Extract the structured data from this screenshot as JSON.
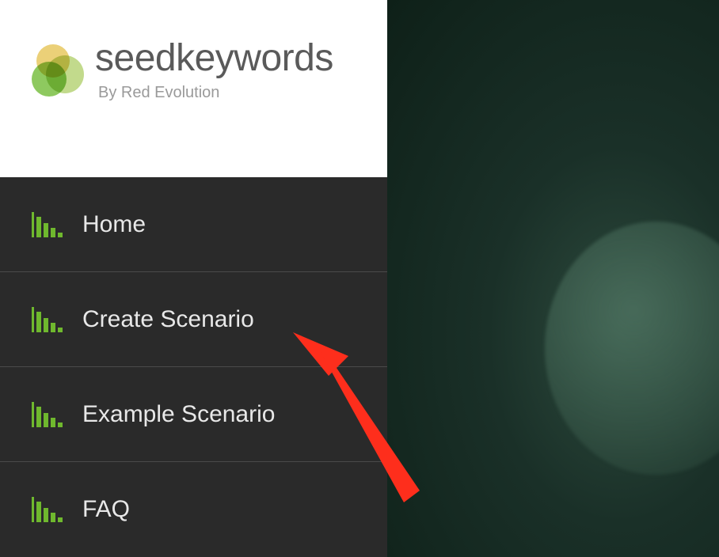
{
  "logo": {
    "bold": "seed",
    "light": "keywords",
    "tagline": "By Red Evolution"
  },
  "nav": {
    "items": [
      {
        "label": "Home"
      },
      {
        "label": "Create Scenario"
      },
      {
        "label": "Example Scenario"
      },
      {
        "label": "FAQ"
      }
    ]
  },
  "annotation": {
    "arrow_target": "create-scenario"
  },
  "colors": {
    "accent": "#6fb82e",
    "arrow": "#fe2e1c"
  }
}
